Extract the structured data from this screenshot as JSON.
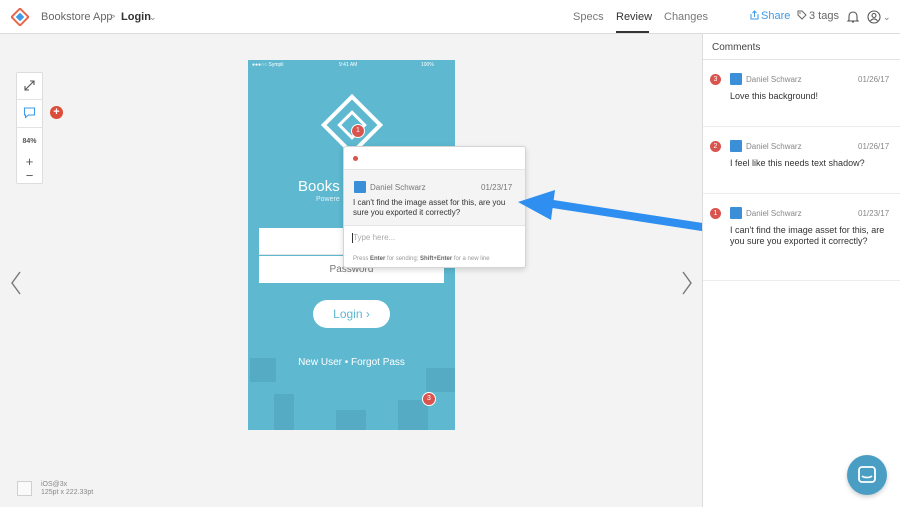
{
  "header": {
    "app_name": "Bookstore App",
    "separator": ">",
    "page_name": "Login",
    "tabs": [
      {
        "label": "Specs",
        "active": false
      },
      {
        "label": "Review",
        "active": true
      },
      {
        "label": "Changes",
        "active": false
      }
    ],
    "share_label": "Share",
    "tags_label": "3 tags",
    "icons": {
      "logo": "zeplin-logo-icon",
      "bell": "bell-icon",
      "user": "user-icon"
    }
  },
  "toolbar": {
    "zoom_level": "84%",
    "icons": [
      "expand-icon",
      "comment-icon",
      "zoom-in-icon",
      "zoom-out-icon"
    ]
  },
  "artboard": {
    "status_carrier": "●●●○○ Sympli",
    "status_time": "9:41 AM",
    "status_battery": "100%",
    "title": "Books",
    "subtitle": "Powere",
    "email_placeholder": "E",
    "password_placeholder": "Password",
    "login_label": "Login",
    "links": "New User • Forgot Pass"
  },
  "popover": {
    "author": "Daniel Schwarz",
    "date": "01/23/17",
    "text": "I can't find the image asset for this, are you sure you exported it correctly?",
    "input_placeholder": "Type here...",
    "hint_1": "Press ",
    "hint_enter": "Enter",
    "hint_2": " for sending; ",
    "hint_shift": "Shift+Enter",
    "hint_3": " for a new line"
  },
  "pins": {
    "first": "1",
    "third": "3"
  },
  "comments": {
    "title": "Comments",
    "items": [
      {
        "badge": "3",
        "author": "Daniel Schwarz",
        "date": "01/26/17",
        "text": "Love this background!"
      },
      {
        "badge": "2",
        "author": "Daniel Schwarz",
        "date": "01/26/17",
        "text": "I feel like this needs text shadow?"
      },
      {
        "badge": "1",
        "author": "Daniel Schwarz",
        "date": "01/23/17",
        "text": "I can't find the image asset for this, are you sure you exported it correctly?"
      }
    ]
  },
  "bottom_info": {
    "density": "iOS@3x",
    "size": "125pt x 222.33pt"
  },
  "colors": {
    "accent": "#3d9be9",
    "artboard": "#5db8d0",
    "badge": "#d9534f",
    "chat": "#4a9ec4"
  }
}
